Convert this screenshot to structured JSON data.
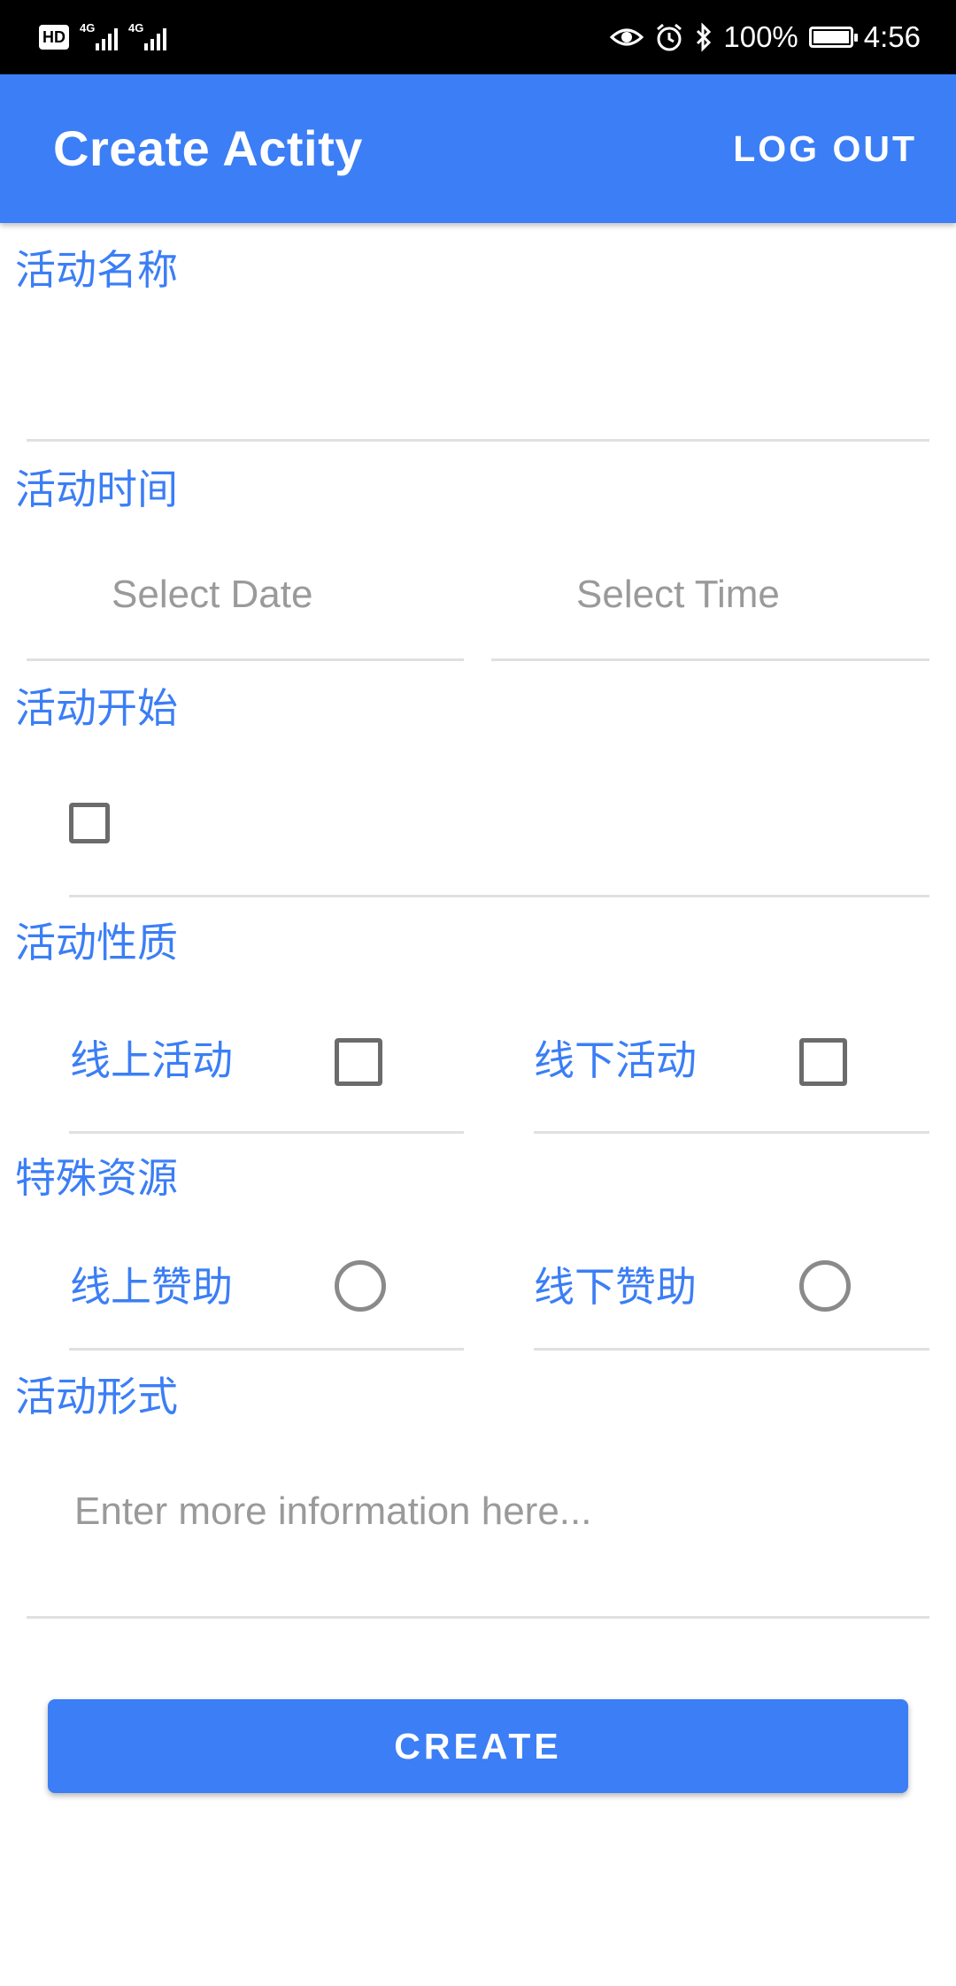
{
  "status_bar": {
    "hd": "HD",
    "net1": "4G",
    "net2": "4G",
    "battery_text": "100%",
    "time": "4:56",
    "battery_level": 1.0
  },
  "app_bar": {
    "title": "Create Actity",
    "logout_label": "LOG OUT"
  },
  "form": {
    "name_label": "活动名称",
    "time_label": "活动时间",
    "date_placeholder": "Select Date",
    "time_placeholder": "Select Time",
    "start_label": "活动开始",
    "nature_label": "活动性质",
    "online_activity": "线上活动",
    "offline_activity": "线下活动",
    "resource_label": "特殊资源",
    "online_sponsor": "线上赞助",
    "offline_sponsor": "线下赞助",
    "format_label": "活动形式",
    "format_placeholder": "Enter more information here...",
    "create_label": "CREATE"
  },
  "colors": {
    "accent": "#3b7ef6",
    "status_bar": "#000000",
    "divider": "#e0e0e0"
  }
}
